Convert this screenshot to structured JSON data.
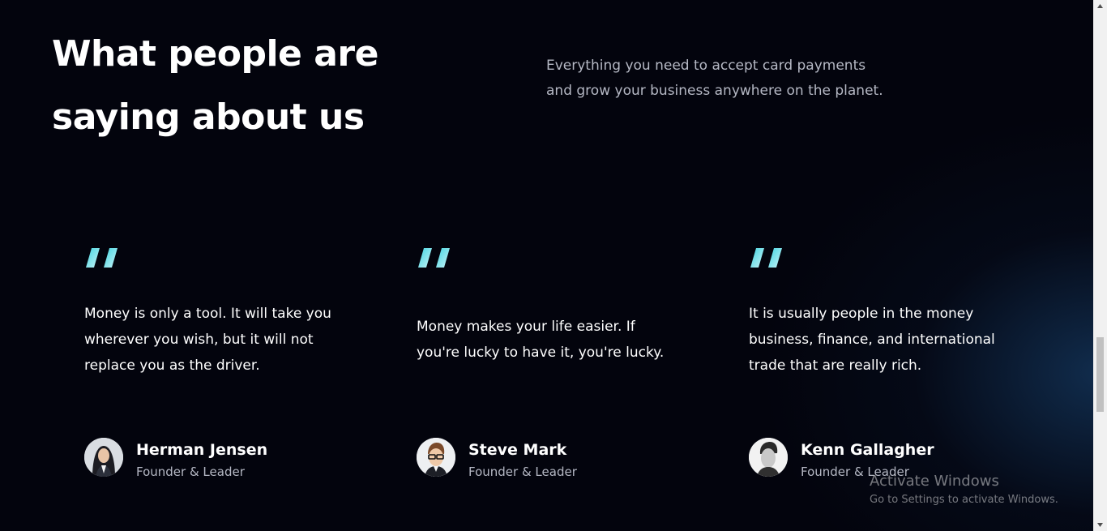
{
  "header": {
    "title_line1": "What people are",
    "title_line2": "saying about us",
    "subtitle_line1": "Everything you need to accept card payments",
    "subtitle_line2": "and grow your business anywhere on the planet."
  },
  "testimonials": [
    {
      "quote_icon": "quote-icon",
      "quote": "Money is only a tool. It will take you wherever you wish, but it will not replace you as the driver.",
      "name": "Herman Jensen",
      "role": "Founder & Leader",
      "avatar": "avatar-woman-long-dark-hair"
    },
    {
      "quote_icon": "quote-icon",
      "quote": "Money makes your life easier. If you're lucky to have it, you're lucky.",
      "name": "Steve Mark",
      "role": "Founder & Leader",
      "avatar": "avatar-man-glasses"
    },
    {
      "quote_icon": "quote-icon",
      "quote": "It is usually people in the money business, finance, and international trade that are really rich.",
      "name": "Kenn Gallagher",
      "role": "Founder & Leader",
      "avatar": "avatar-man-black-white"
    }
  ],
  "watermark": {
    "title": "Activate Windows",
    "subtitle": "Go to Settings to activate Windows."
  },
  "colors": {
    "background": "#03040d",
    "quote_gradient_start": "#3fd4e0",
    "quote_gradient_end": "#c9f3f7",
    "muted_text": "#b5b8c4"
  }
}
